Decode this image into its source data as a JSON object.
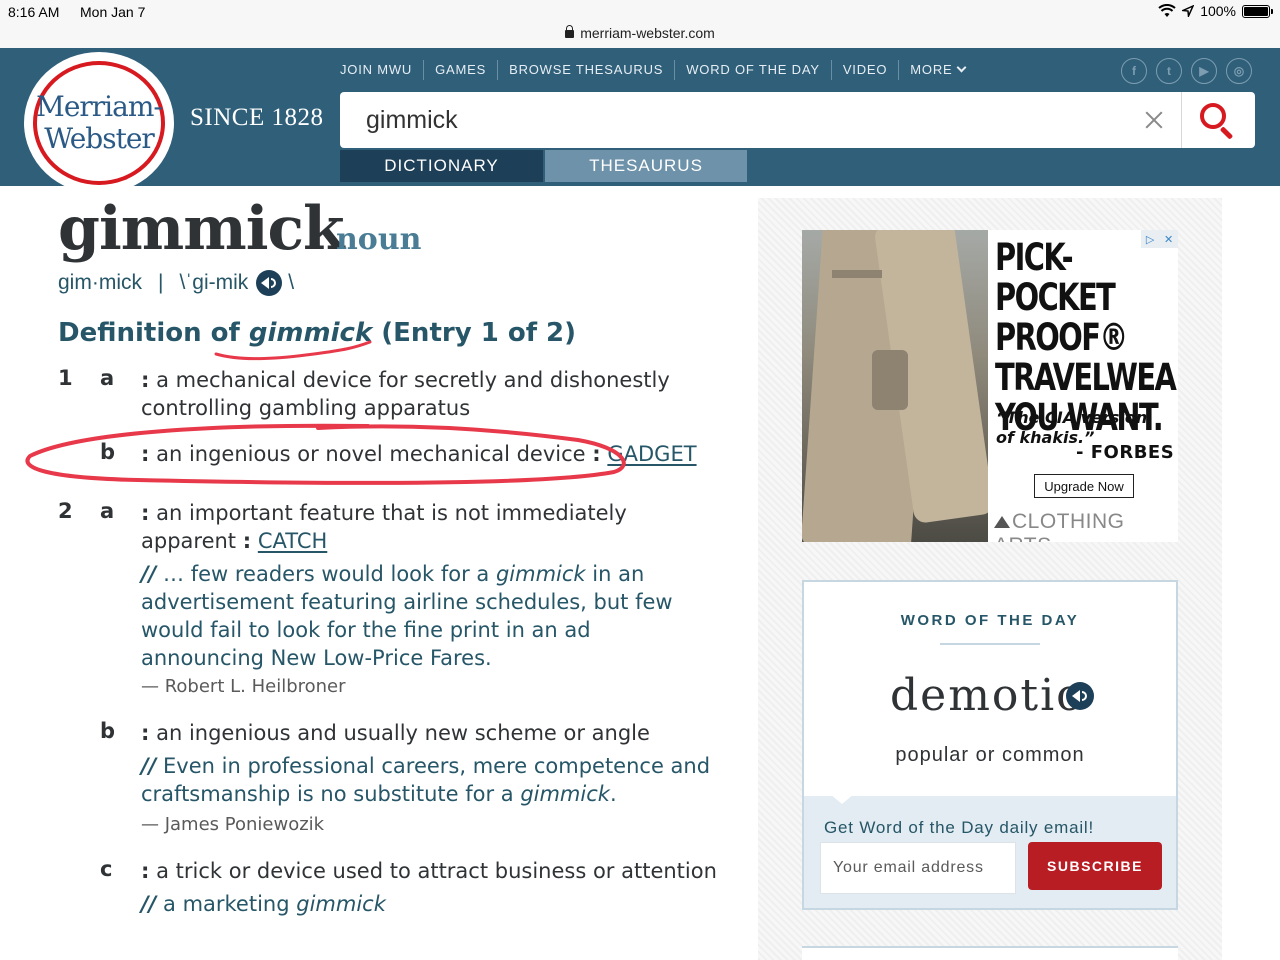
{
  "status_bar": {
    "time": "8:16 AM",
    "date": "Mon Jan 7",
    "url": "merriam-webster.com",
    "battery": "100%"
  },
  "header": {
    "logo_line1": "Merriam-",
    "logo_line2": "Webster",
    "since": "SINCE 1828",
    "nav": [
      "JOIN MWU",
      "GAMES",
      "BROWSE THESAURUS",
      "WORD OF THE DAY",
      "VIDEO",
      "MORE"
    ],
    "social_icons": [
      "facebook-icon",
      "twitter-icon",
      "youtube-icon",
      "instagram-icon"
    ],
    "search_value": "gimmick",
    "tab_dictionary": "DICTIONARY",
    "tab_thesaurus": "THESAURUS"
  },
  "entry": {
    "headword": "gimmick",
    "pos": "noun",
    "syllables": "gim·mick",
    "separator": "|",
    "pron_open": "\\ˈgi-mik",
    "pron_close": "\\",
    "def_prefix": "Definition of ",
    "def_word": "gimmick",
    "def_suffix": " (Entry 1 of 2)",
    "senses": {
      "n1": "1",
      "n1a": "a",
      "s1a_l1": "a mechanical device for secretly and dishonestly",
      "s1a_l2": "controlling gambling apparatus",
      "n1b": "b",
      "s1b": "an ingenious or novel mechanical device",
      "s1b_xref": "GADGET",
      "n2": "2",
      "n2a": "a",
      "s2a_l1": "an important feature that is not immediately",
      "s2a_l2": "apparent",
      "s2a_xref": "CATCH",
      "ex2a_l1_pre": " … few readers would look for a ",
      "ex2a_l1_em": "gimmick",
      "ex2a_l1_post": " in an",
      "ex2a_l2": "advertisement featuring airline schedules, but few",
      "ex2a_l3": "would fail to look for the fine print in an ad",
      "ex2a_l4": "announcing New Low-Price Fares.",
      "attr2a": "— Robert L. Heilbroner",
      "n2b": "b",
      "s2b": "an ingenious and usually new scheme or angle",
      "ex2b_l1": " Even in professional careers, mere competence and",
      "ex2b_l2_pre": "craftsmanship is no substitute for a ",
      "ex2b_l2_em": "gimmick",
      "ex2b_l2_post": ".",
      "attr2b": "— James Poniewozik",
      "n2c": "c",
      "s2c": "a trick or device used to attract business or attention",
      "ex2c_pre": " a marketing ",
      "ex2c_em": "gimmick"
    },
    "colon": ":",
    "slashes": "//"
  },
  "ad": {
    "adchoice_1": "▷",
    "adchoice_2": "✕",
    "headline_1": "PICK-POCKET",
    "headline_2": "PROOF®",
    "headline_3": "TRAVELWEAR",
    "headline_4": "YOU WANT.",
    "quote_1": "“The CIA version",
    "quote_2": "of khakis.”",
    "quote_source": "- FORBES",
    "button": "Upgrade Now",
    "brand": "CLOTHING ARTS"
  },
  "wotd": {
    "label": "WORD OF THE DAY",
    "word": "demotic",
    "definition": "popular or common",
    "email_label": "Get Word of the Day daily email!",
    "email_placeholder": "Your email address",
    "subscribe": "SUBSCRIBE"
  },
  "colors": {
    "header_bg": "#305f7a",
    "accent_red": "#d71920",
    "link_teal": "#265667",
    "annotation_red": "#e8394b"
  }
}
